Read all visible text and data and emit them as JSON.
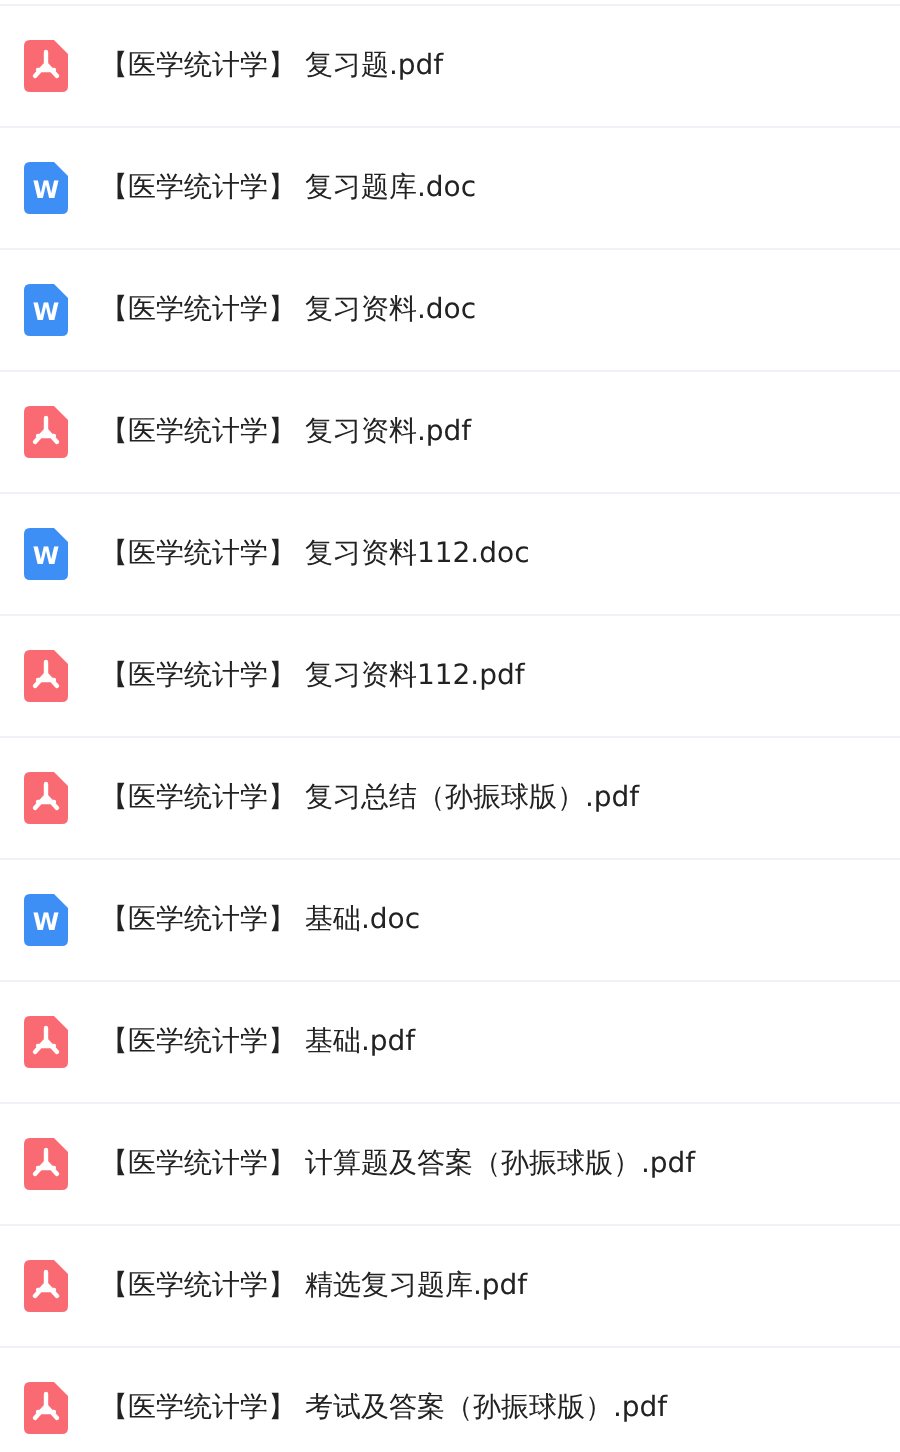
{
  "files": [
    {
      "kind": "pdf",
      "name": "【医学统计学】 复习题.pdf"
    },
    {
      "kind": "word",
      "badge": "W",
      "name": "【医学统计学】 复习题库.doc"
    },
    {
      "kind": "word",
      "badge": "W",
      "name": "【医学统计学】 复习资料.doc"
    },
    {
      "kind": "pdf",
      "name": "【医学统计学】 复习资料.pdf"
    },
    {
      "kind": "word",
      "badge": "W",
      "name": "【医学统计学】 复习资料112.doc"
    },
    {
      "kind": "pdf",
      "name": "【医学统计学】 复习资料112.pdf"
    },
    {
      "kind": "pdf",
      "name": "【医学统计学】 复习总结（孙振球版）.pdf"
    },
    {
      "kind": "word",
      "badge": "W",
      "name": "【医学统计学】 基础.doc"
    },
    {
      "kind": "pdf",
      "name": "【医学统计学】 基础.pdf"
    },
    {
      "kind": "pdf",
      "name": "【医学统计学】 计算题及答案（孙振球版）.pdf"
    },
    {
      "kind": "pdf",
      "name": "【医学统计学】 精选复习题库.pdf"
    },
    {
      "kind": "pdf",
      "name": "【医学统计学】 考试及答案（孙振球版）.pdf"
    }
  ]
}
